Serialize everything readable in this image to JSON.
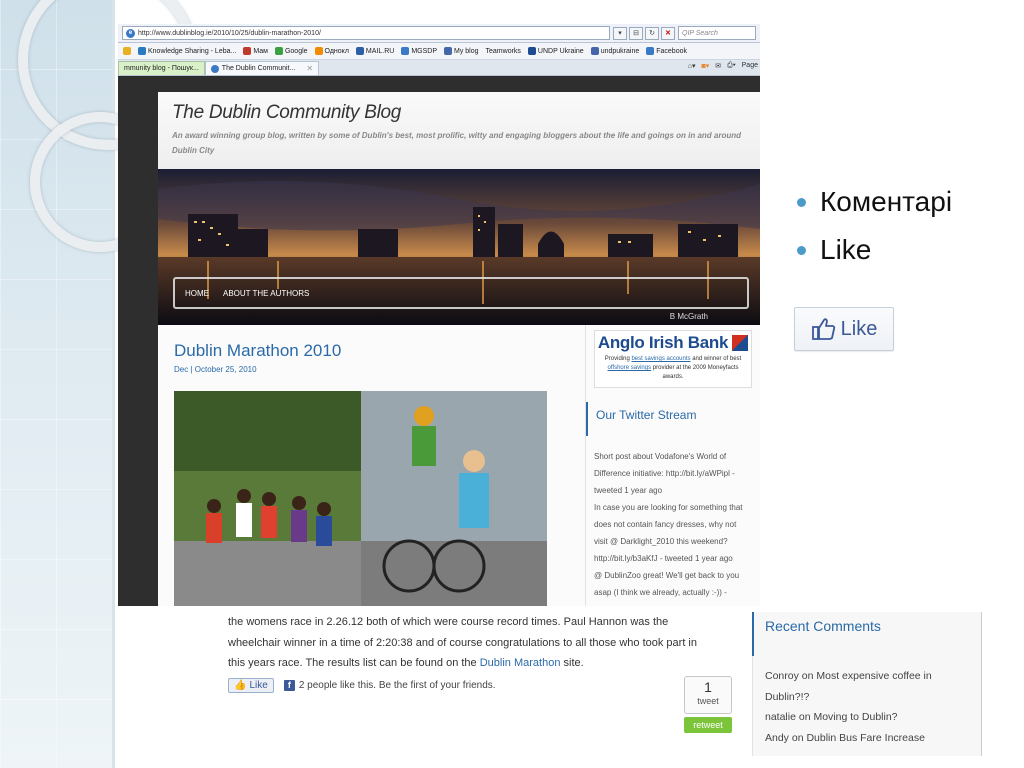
{
  "browser": {
    "url": "http://www.dublinblog.ie/2010/10/25/dublin-marathon-2010/",
    "search_placeholder": "QIP Search",
    "favorites": [
      "Knowledge Sharing - Leba...",
      "Мам",
      "Google",
      "Однокл",
      "MAIL.RU",
      "MGSDP",
      "My blog",
      "Teamworks",
      "UNDP Ukraine",
      "undpukraine",
      "Facebook"
    ],
    "tabs": [
      {
        "label": "mmunity blog - Пошук..."
      },
      {
        "label": "The Dublin Communit..."
      }
    ],
    "page_menu": "Page"
  },
  "blog": {
    "title": "The Dublin Community Blog",
    "tagline": "An award winning group blog, written by some of Dublin's best, most prolific, witty and engaging bloggers about the life and goings on in and around Dublin City",
    "nav": [
      "HOME",
      "ABOUT THE AUTHORS"
    ],
    "banner_credit": "B McGrath",
    "post": {
      "title": "Dublin Marathon 2010",
      "date": "Dec | October 25, 2010"
    },
    "ad": {
      "bank": "Anglo Irish Bank",
      "text_1": "Providing",
      "link_1": "best savings accounts",
      "text_2": "and winner of best",
      "link_2": "offshore savings",
      "text_3": "provider at the 2009 Moneyfacts awards."
    },
    "twitter": {
      "heading": "Our Twitter Stream",
      "lines": [
        "Short post about Vodafone's World of",
        "Difference initiative:  http://bit.ly/aWPipl  -",
        "tweeted 1 year ago",
        "In case you are looking for something that",
        "does not contain fancy dresses, why not",
        "visit @ Darklight_2010  this weekend?",
        " http://bit.ly/b3aKfJ  - tweeted 1 year ago",
        "@ DublinZoo  great! We'll get back to you",
        "asap (I think we already, actually :-)) -"
      ]
    }
  },
  "lower": {
    "line_1": "the womens race in 2.26.12 both of which were course record times. Paul Hannon was the",
    "line_2": "wheelchair winner in a time of 2:20:38 and of course congratulations to all those who took part in",
    "line_3_pre": "this years race. The results list can be found on the",
    "line_3_link": "Dublin Marathon",
    "line_3_post": "site.",
    "like_label": "Like",
    "like_text": "2 people like this. Be the first of your friends.",
    "tweet_count": "1",
    "tweet_word": "tweet",
    "retweet": "retweet",
    "recent_heading": "Recent Comments",
    "recent_items": [
      "Conroy on Most expensive coffee in",
      "Dublin?!?",
      "natalie on Moving to Dublin?",
      "Andy on Dublin Bus Fare Increase"
    ]
  },
  "slide": {
    "bullets": [
      "Коментарі",
      "Like"
    ],
    "like_button": "Like",
    "accent": "#4a9bc9"
  }
}
